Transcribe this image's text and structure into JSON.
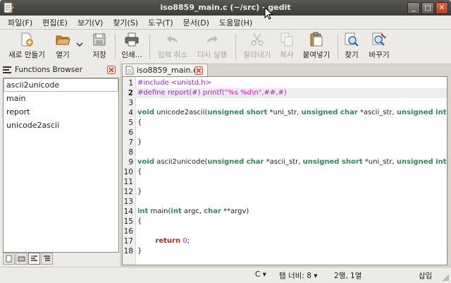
{
  "window": {
    "title": "iso8859_main.c (~/src) - gedit"
  },
  "menu": [
    "파일(F)",
    "편집(E)",
    "보기(V)",
    "찾기(S)",
    "도구(T)",
    "문서(D)",
    "도움말(H)"
  ],
  "toolbar": {
    "new_label": "새로 만들기",
    "open_label": "열기",
    "save_label": "저장",
    "print_label": "인쇄...",
    "undo_label": "입력 취소",
    "redo_label": "다시 실행",
    "cut_label": "잘라내기",
    "copy_label": "복사",
    "paste_label": "붙여넣기",
    "find_label": "찾기",
    "replace_label": "바꾸기"
  },
  "sidebar": {
    "title": "Functions Browser",
    "items": [
      "ascii2unicode",
      "main",
      "report",
      "unicode2ascii"
    ]
  },
  "editor": {
    "tab_label": "iso8859_main.c",
    "line_numbers": [
      "1",
      "2",
      "3",
      "4",
      "5",
      "6",
      "7",
      "8",
      "9",
      "10",
      "11",
      "12",
      "13",
      "14",
      "15",
      "16",
      "17",
      "18"
    ],
    "current_line": 2
  },
  "status": {
    "language": "C",
    "tab_width": "탭 너비:  8",
    "position": "2행, 1열",
    "mode": "삽입"
  },
  "colors": {
    "preprocessor": "#a020f0",
    "type": "#2e8b57",
    "keyword": "#a52a2a",
    "number": "#ff00ff",
    "titlebar": "#3c3b37"
  }
}
